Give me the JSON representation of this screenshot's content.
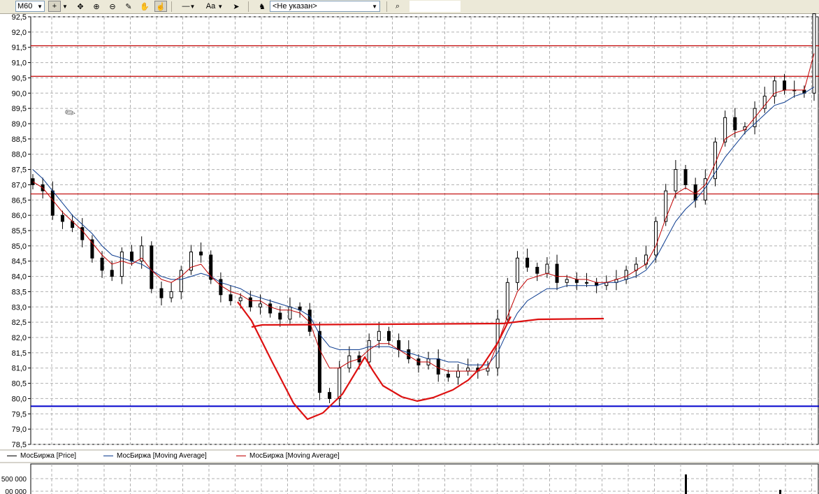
{
  "toolbar": {
    "timeframe": "M60",
    "font_button": "Aa",
    "instrument": "<Не указан>",
    "search_value": ""
  },
  "colors": {
    "price": "#000000",
    "ma_slow": "#0b3b8f",
    "ma_fast": "#c00000",
    "horizontal_lines": "#c00000",
    "support_line": "#0000cc",
    "pattern_drawing": "#dd1111",
    "grid": "#b0b0b0"
  },
  "icons": [
    "crosshair-icon",
    "move-icon",
    "zoom-in-icon",
    "zoom-out-icon",
    "ruler-icon",
    "hand-icon",
    "select-icon",
    "line-style-icon",
    "arrow-icon",
    "instrument-icon",
    "search-icon",
    "cursor-icon"
  ],
  "chart_data": {
    "type": "line",
    "title": "",
    "y_ticks": [
      "92,5",
      "92,0",
      "91,5",
      "91,0",
      "90,5",
      "90,0",
      "89,5",
      "89,0",
      "88,5",
      "88,0",
      "87,5",
      "87,0",
      "86,5",
      "86,0",
      "85,5",
      "85,0",
      "84,5",
      "84,0",
      "83,5",
      "83,0",
      "82,5",
      "82,0",
      "81,5",
      "81,0",
      "80,5",
      "80,0",
      "79,5",
      "79,0",
      "78,5"
    ],
    "ylim": [
      78.5,
      92.5
    ],
    "grid": true,
    "series": [
      {
        "name": "МосБиржа [Price]",
        "style": "candlestick",
        "closes": [
          87.0,
          86.8,
          86.0,
          85.8,
          85.6,
          85.2,
          84.6,
          84.2,
          84.0,
          84.8,
          84.5,
          85.0,
          83.6,
          83.3,
          83.5,
          84.2,
          84.8,
          84.7,
          83.9,
          83.4,
          83.2,
          83.3,
          83.0,
          83.1,
          82.8,
          82.6,
          83.0,
          82.9,
          82.2,
          80.2,
          80.0,
          81.0,
          81.4,
          81.2,
          81.9,
          82.2,
          81.9,
          81.6,
          81.3,
          81.1,
          81.3,
          80.8,
          80.7,
          80.9,
          81.0,
          80.9,
          81.0,
          82.6,
          83.8,
          84.6,
          84.3,
          84.1,
          84.4,
          83.8,
          83.9,
          83.8,
          83.8,
          83.7,
          83.8,
          83.9,
          84.2,
          84.4,
          84.7,
          85.8,
          86.8,
          87.5,
          87.0,
          86.5,
          87.2,
          88.4,
          89.2,
          88.8,
          88.9,
          89.5,
          89.9,
          90.4,
          90.1,
          90.1,
          90.0,
          92.6
        ]
      },
      {
        "name": "МосБиржа [Moving Average]",
        "style": "line",
        "values": [
          87.5,
          87.2,
          86.8,
          86.4,
          86.0,
          85.7,
          85.4,
          85.0,
          84.7,
          84.6,
          84.5,
          84.4,
          84.2,
          84.0,
          83.9,
          83.9,
          84.0,
          84.1,
          84.0,
          83.8,
          83.7,
          83.6,
          83.4,
          83.3,
          83.2,
          83.1,
          83.0,
          82.9,
          82.7,
          82.1,
          81.7,
          81.6,
          81.6,
          81.6,
          81.7,
          81.7,
          81.7,
          81.6,
          81.5,
          81.4,
          81.3,
          81.3,
          81.2,
          81.2,
          81.1,
          81.1,
          81.1,
          81.5,
          82.2,
          82.8,
          83.2,
          83.4,
          83.6,
          83.6,
          83.7,
          83.7,
          83.7,
          83.7,
          83.8,
          83.8,
          83.9,
          84.0,
          84.2,
          84.6,
          85.2,
          85.8,
          86.2,
          86.5,
          86.9,
          87.4,
          87.9,
          88.3,
          88.7,
          89.0,
          89.3,
          89.6,
          89.7,
          89.9,
          90.0,
          90.2
        ]
      },
      {
        "name": "МосБиржа [Moving Average]",
        "style": "line",
        "values": [
          87.1,
          86.9,
          86.5,
          86.1,
          85.8,
          85.5,
          85.1,
          84.7,
          84.4,
          84.5,
          84.4,
          84.6,
          84.2,
          83.9,
          83.8,
          84.0,
          84.3,
          84.4,
          84.0,
          83.7,
          83.5,
          83.4,
          83.2,
          83.2,
          83.0,
          82.9,
          82.9,
          82.8,
          82.5,
          81.6,
          81.0,
          81.0,
          81.2,
          81.3,
          81.6,
          81.8,
          81.8,
          81.6,
          81.4,
          81.2,
          81.2,
          81.0,
          80.9,
          80.9,
          80.9,
          80.9,
          81.0,
          81.8,
          82.7,
          83.5,
          83.9,
          84.0,
          84.1,
          84.0,
          84.0,
          83.9,
          83.9,
          83.8,
          83.8,
          83.9,
          84.0,
          84.2,
          84.4,
          85.0,
          85.9,
          86.7,
          86.9,
          86.7,
          87.0,
          87.7,
          88.5,
          88.7,
          88.8,
          89.2,
          89.6,
          90.0,
          90.1,
          90.1,
          90.1,
          91.3
        ]
      }
    ],
    "horizontal_levels": [
      91.55,
      90.55,
      86.7
    ],
    "support_level": 79.75,
    "volume_ticks": [
      "500 000",
      "00 000"
    ]
  },
  "legend": [
    {
      "label": "МосБиржа [Price]",
      "color": "#000000"
    },
    {
      "label": "МосБиржа [Moving Average]",
      "color": "#0b3b8f"
    },
    {
      "label": "МосБиржа [Moving Average]",
      "color": "#c00000"
    }
  ]
}
